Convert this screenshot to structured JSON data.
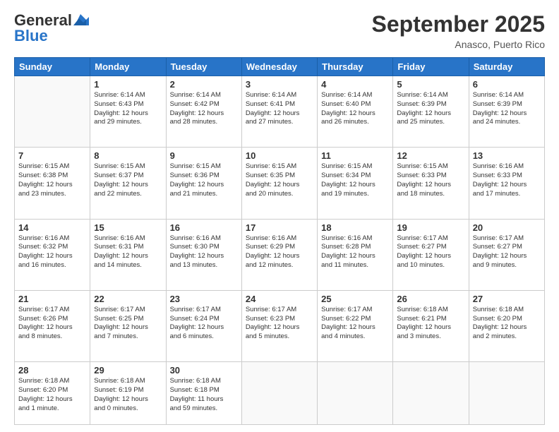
{
  "header": {
    "logo_general": "General",
    "logo_blue": "Blue",
    "month_title": "September 2025",
    "location": "Anasco, Puerto Rico"
  },
  "days_of_week": [
    "Sunday",
    "Monday",
    "Tuesday",
    "Wednesday",
    "Thursday",
    "Friday",
    "Saturday"
  ],
  "weeks": [
    [
      {
        "day": "",
        "info": ""
      },
      {
        "day": "1",
        "info": "Sunrise: 6:14 AM\nSunset: 6:43 PM\nDaylight: 12 hours\nand 29 minutes."
      },
      {
        "day": "2",
        "info": "Sunrise: 6:14 AM\nSunset: 6:42 PM\nDaylight: 12 hours\nand 28 minutes."
      },
      {
        "day": "3",
        "info": "Sunrise: 6:14 AM\nSunset: 6:41 PM\nDaylight: 12 hours\nand 27 minutes."
      },
      {
        "day": "4",
        "info": "Sunrise: 6:14 AM\nSunset: 6:40 PM\nDaylight: 12 hours\nand 26 minutes."
      },
      {
        "day": "5",
        "info": "Sunrise: 6:14 AM\nSunset: 6:39 PM\nDaylight: 12 hours\nand 25 minutes."
      },
      {
        "day": "6",
        "info": "Sunrise: 6:14 AM\nSunset: 6:39 PM\nDaylight: 12 hours\nand 24 minutes."
      }
    ],
    [
      {
        "day": "7",
        "info": "Sunrise: 6:15 AM\nSunset: 6:38 PM\nDaylight: 12 hours\nand 23 minutes."
      },
      {
        "day": "8",
        "info": "Sunrise: 6:15 AM\nSunset: 6:37 PM\nDaylight: 12 hours\nand 22 minutes."
      },
      {
        "day": "9",
        "info": "Sunrise: 6:15 AM\nSunset: 6:36 PM\nDaylight: 12 hours\nand 21 minutes."
      },
      {
        "day": "10",
        "info": "Sunrise: 6:15 AM\nSunset: 6:35 PM\nDaylight: 12 hours\nand 20 minutes."
      },
      {
        "day": "11",
        "info": "Sunrise: 6:15 AM\nSunset: 6:34 PM\nDaylight: 12 hours\nand 19 minutes."
      },
      {
        "day": "12",
        "info": "Sunrise: 6:15 AM\nSunset: 6:33 PM\nDaylight: 12 hours\nand 18 minutes."
      },
      {
        "day": "13",
        "info": "Sunrise: 6:16 AM\nSunset: 6:33 PM\nDaylight: 12 hours\nand 17 minutes."
      }
    ],
    [
      {
        "day": "14",
        "info": "Sunrise: 6:16 AM\nSunset: 6:32 PM\nDaylight: 12 hours\nand 16 minutes."
      },
      {
        "day": "15",
        "info": "Sunrise: 6:16 AM\nSunset: 6:31 PM\nDaylight: 12 hours\nand 14 minutes."
      },
      {
        "day": "16",
        "info": "Sunrise: 6:16 AM\nSunset: 6:30 PM\nDaylight: 12 hours\nand 13 minutes."
      },
      {
        "day": "17",
        "info": "Sunrise: 6:16 AM\nSunset: 6:29 PM\nDaylight: 12 hours\nand 12 minutes."
      },
      {
        "day": "18",
        "info": "Sunrise: 6:16 AM\nSunset: 6:28 PM\nDaylight: 12 hours\nand 11 minutes."
      },
      {
        "day": "19",
        "info": "Sunrise: 6:17 AM\nSunset: 6:27 PM\nDaylight: 12 hours\nand 10 minutes."
      },
      {
        "day": "20",
        "info": "Sunrise: 6:17 AM\nSunset: 6:27 PM\nDaylight: 12 hours\nand 9 minutes."
      }
    ],
    [
      {
        "day": "21",
        "info": "Sunrise: 6:17 AM\nSunset: 6:26 PM\nDaylight: 12 hours\nand 8 minutes."
      },
      {
        "day": "22",
        "info": "Sunrise: 6:17 AM\nSunset: 6:25 PM\nDaylight: 12 hours\nand 7 minutes."
      },
      {
        "day": "23",
        "info": "Sunrise: 6:17 AM\nSunset: 6:24 PM\nDaylight: 12 hours\nand 6 minutes."
      },
      {
        "day": "24",
        "info": "Sunrise: 6:17 AM\nSunset: 6:23 PM\nDaylight: 12 hours\nand 5 minutes."
      },
      {
        "day": "25",
        "info": "Sunrise: 6:17 AM\nSunset: 6:22 PM\nDaylight: 12 hours\nand 4 minutes."
      },
      {
        "day": "26",
        "info": "Sunrise: 6:18 AM\nSunset: 6:21 PM\nDaylight: 12 hours\nand 3 minutes."
      },
      {
        "day": "27",
        "info": "Sunrise: 6:18 AM\nSunset: 6:20 PM\nDaylight: 12 hours\nand 2 minutes."
      }
    ],
    [
      {
        "day": "28",
        "info": "Sunrise: 6:18 AM\nSunset: 6:20 PM\nDaylight: 12 hours\nand 1 minute."
      },
      {
        "day": "29",
        "info": "Sunrise: 6:18 AM\nSunset: 6:19 PM\nDaylight: 12 hours\nand 0 minutes."
      },
      {
        "day": "30",
        "info": "Sunrise: 6:18 AM\nSunset: 6:18 PM\nDaylight: 11 hours\nand 59 minutes."
      },
      {
        "day": "",
        "info": ""
      },
      {
        "day": "",
        "info": ""
      },
      {
        "day": "",
        "info": ""
      },
      {
        "day": "",
        "info": ""
      }
    ]
  ]
}
